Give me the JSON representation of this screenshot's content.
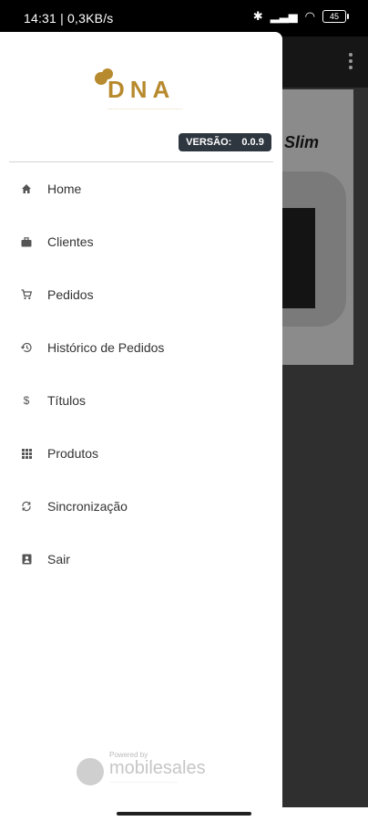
{
  "status_bar": {
    "time_speed": "14:31 | 0,3KB/s",
    "battery": "45"
  },
  "drawer": {
    "logo_text": "DNA",
    "version_label": "VERSÃO:",
    "version_value": "0.0.9",
    "menu": [
      {
        "label": "Home",
        "icon": "home-icon"
      },
      {
        "label": "Clientes",
        "icon": "briefcase-icon"
      },
      {
        "label": "Pedidos",
        "icon": "cart-icon"
      },
      {
        "label": "Histórico de Pedidos",
        "icon": "history-icon"
      },
      {
        "label": "Títulos",
        "icon": "dollar-icon"
      },
      {
        "label": "Produtos",
        "icon": "grid-icon"
      },
      {
        "label": "Sincronização",
        "icon": "sync-icon"
      },
      {
        "label": "Sair",
        "icon": "logout-icon"
      }
    ],
    "powered_by": "Powered by",
    "powered_brand": "mobilesales"
  },
  "background_app": {
    "banner_text": "Slim"
  }
}
